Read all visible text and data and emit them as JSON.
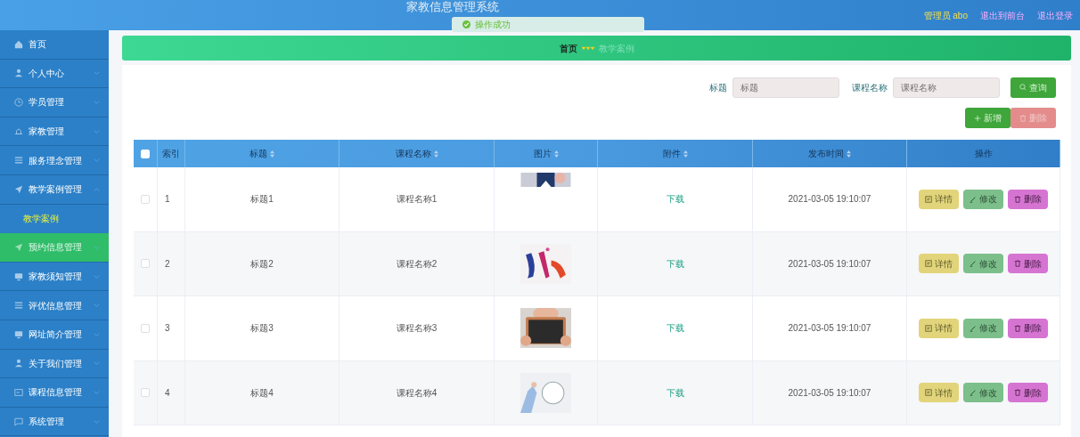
{
  "header": {
    "title": "家教信息管理系统",
    "user": "管理员 abo",
    "links": [
      "退出到前台",
      "退出登录"
    ]
  },
  "toast": {
    "text": "操作成功"
  },
  "sidebar": {
    "items": [
      {
        "label": "首页",
        "selected": false
      },
      {
        "label": "个人中心",
        "selected": false,
        "expanded": false
      },
      {
        "label": "学员管理",
        "selected": false,
        "expanded": false
      },
      {
        "label": "家教管理",
        "selected": false,
        "expanded": false
      },
      {
        "label": "服务理念管理",
        "selected": false,
        "expanded": false
      },
      {
        "label": "教学案例管理",
        "selected": false,
        "expanded": true,
        "children": [
          {
            "label": "教学案例",
            "selected": true
          }
        ]
      },
      {
        "label": "预约信息管理",
        "selected": true,
        "expanded": false
      },
      {
        "label": "家教须知管理",
        "selected": false,
        "expanded": false
      },
      {
        "label": "评优信息管理",
        "selected": false,
        "expanded": false
      },
      {
        "label": "网址简介管理",
        "selected": false,
        "expanded": false
      },
      {
        "label": "关于我们管理",
        "selected": false,
        "expanded": false
      },
      {
        "label": "课程信息管理",
        "selected": false,
        "expanded": false
      },
      {
        "label": "系统管理",
        "selected": false,
        "expanded": false
      }
    ]
  },
  "breadcrumb": [
    "首页",
    "教学案例"
  ],
  "search": {
    "fields": [
      {
        "label": "标题",
        "placeholder": "标题"
      },
      {
        "label": "课程名称",
        "placeholder": "课程名称"
      }
    ],
    "button": "查询"
  },
  "actions": [
    {
      "label": "新增",
      "kind": "add",
      "disabled": false
    },
    {
      "label": "删除",
      "kind": "delete",
      "disabled": true
    }
  ],
  "table": {
    "columns": [
      "索引",
      "标题",
      "课程名称",
      "图片",
      "附件",
      "发布时间",
      "操作"
    ],
    "header_checked": false,
    "rows": [
      {
        "checked": false,
        "index": "1",
        "title": "标题1",
        "course": "课程名称1",
        "attachment": "下载",
        "time": "2021-03-05 19:10:07",
        "buttons": [
          "详情",
          "修改",
          "删除"
        ]
      },
      {
        "checked": false,
        "index": "2",
        "title": "标题2",
        "course": "课程名称2",
        "attachment": "下载",
        "time": "2021-03-05 19:10:07",
        "buttons": [
          "详情",
          "修改",
          "删除"
        ]
      },
      {
        "checked": false,
        "index": "3",
        "title": "标题3",
        "course": "课程名称3",
        "attachment": "下载",
        "time": "2021-03-05 19:10:07",
        "buttons": [
          "详情",
          "修改",
          "删除"
        ]
      },
      {
        "checked": false,
        "index": "4",
        "title": "标题4",
        "course": "课程名称4",
        "attachment": "下载",
        "time": "2021-03-05 19:10:07",
        "buttons": [
          "详情",
          "修改",
          "删除"
        ]
      }
    ]
  }
}
